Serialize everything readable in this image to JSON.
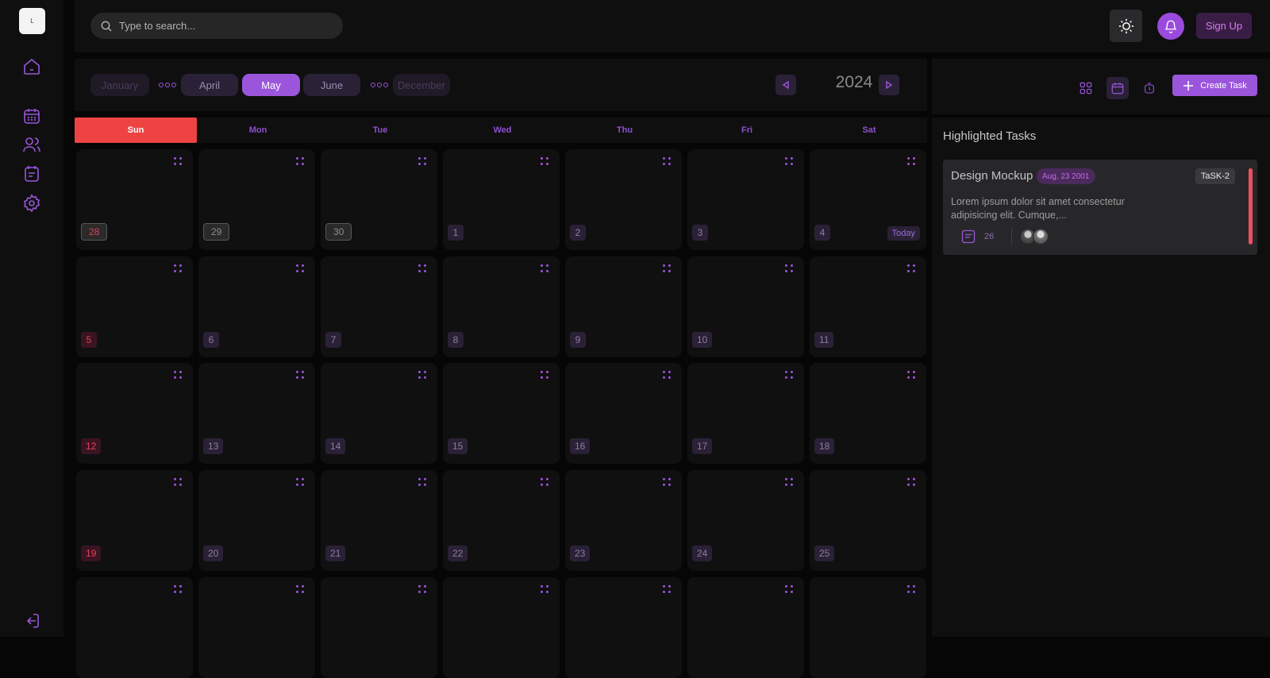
{
  "sidebar": {
    "logo_text": "L",
    "items": [
      {
        "name": "home-icon"
      },
      {
        "name": "calendar-icon"
      },
      {
        "name": "users-icon"
      },
      {
        "name": "tasks-icon"
      },
      {
        "name": "gear-icon"
      }
    ],
    "logout_icon": "logout-icon"
  },
  "header": {
    "search_placeholder": "Type to search...",
    "theme_icon": "sun-icon",
    "notification_icon": "bell-icon",
    "signup_label": "Sign Up"
  },
  "months": {
    "items": [
      "January",
      "April",
      "May",
      "June",
      "December"
    ],
    "active": "May",
    "year": "2024"
  },
  "weekdays": [
    "Sun",
    "Mon",
    "Tue",
    "Wed",
    "Thu",
    "Fri",
    "Sat"
  ],
  "calendar": {
    "today_label": "Today",
    "weeks": [
      [
        "28",
        "29",
        "30",
        "1",
        "2",
        "3",
        "4"
      ],
      [
        "5",
        "6",
        "7",
        "8",
        "9",
        "10",
        "11"
      ],
      [
        "12",
        "13",
        "14",
        "15",
        "16",
        "17",
        "18"
      ],
      [
        "19",
        "20",
        "21",
        "22",
        "23",
        "24",
        "25"
      ],
      [
        "",
        "",
        "",
        "",
        "",
        "",
        ""
      ]
    ]
  },
  "right_panel": {
    "view_icons": [
      "grid-icon",
      "calendar-icon",
      "alarm-icon"
    ],
    "create_label": "Create Task",
    "section_title": "Highlighted Tasks",
    "task": {
      "title": "Design Mockup",
      "date": "Aug, 23 2001",
      "id": "TaSK-2",
      "description": "Lorem ipsum dolor sit amet consectetur adipisicing elit. Cumque,...",
      "comments": "26"
    }
  },
  "colors": {
    "accent": "#9b55db",
    "sunday": "#ee4343",
    "background": "#060606",
    "panel": "#0f0f10"
  }
}
